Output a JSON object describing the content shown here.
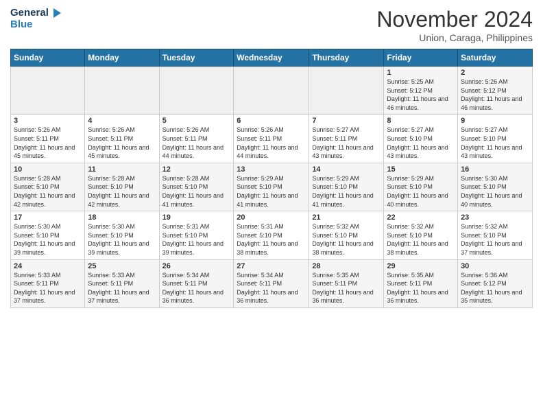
{
  "header": {
    "logo_line1": "General",
    "logo_line2": "Blue",
    "month_title": "November 2024",
    "location": "Union, Caraga, Philippines"
  },
  "weekdays": [
    "Sunday",
    "Monday",
    "Tuesday",
    "Wednesday",
    "Thursday",
    "Friday",
    "Saturday"
  ],
  "weeks": [
    [
      {
        "day": "",
        "sunrise": "",
        "sunset": "",
        "daylight": ""
      },
      {
        "day": "",
        "sunrise": "",
        "sunset": "",
        "daylight": ""
      },
      {
        "day": "",
        "sunrise": "",
        "sunset": "",
        "daylight": ""
      },
      {
        "day": "",
        "sunrise": "",
        "sunset": "",
        "daylight": ""
      },
      {
        "day": "",
        "sunrise": "",
        "sunset": "",
        "daylight": ""
      },
      {
        "day": "1",
        "sunrise": "Sunrise: 5:25 AM",
        "sunset": "Sunset: 5:12 PM",
        "daylight": "Daylight: 11 hours and 46 minutes."
      },
      {
        "day": "2",
        "sunrise": "Sunrise: 5:26 AM",
        "sunset": "Sunset: 5:12 PM",
        "daylight": "Daylight: 11 hours and 46 minutes."
      }
    ],
    [
      {
        "day": "3",
        "sunrise": "Sunrise: 5:26 AM",
        "sunset": "Sunset: 5:11 PM",
        "daylight": "Daylight: 11 hours and 45 minutes."
      },
      {
        "day": "4",
        "sunrise": "Sunrise: 5:26 AM",
        "sunset": "Sunset: 5:11 PM",
        "daylight": "Daylight: 11 hours and 45 minutes."
      },
      {
        "day": "5",
        "sunrise": "Sunrise: 5:26 AM",
        "sunset": "Sunset: 5:11 PM",
        "daylight": "Daylight: 11 hours and 44 minutes."
      },
      {
        "day": "6",
        "sunrise": "Sunrise: 5:26 AM",
        "sunset": "Sunset: 5:11 PM",
        "daylight": "Daylight: 11 hours and 44 minutes."
      },
      {
        "day": "7",
        "sunrise": "Sunrise: 5:27 AM",
        "sunset": "Sunset: 5:11 PM",
        "daylight": "Daylight: 11 hours and 43 minutes."
      },
      {
        "day": "8",
        "sunrise": "Sunrise: 5:27 AM",
        "sunset": "Sunset: 5:10 PM",
        "daylight": "Daylight: 11 hours and 43 minutes."
      },
      {
        "day": "9",
        "sunrise": "Sunrise: 5:27 AM",
        "sunset": "Sunset: 5:10 PM",
        "daylight": "Daylight: 11 hours and 43 minutes."
      }
    ],
    [
      {
        "day": "10",
        "sunrise": "Sunrise: 5:28 AM",
        "sunset": "Sunset: 5:10 PM",
        "daylight": "Daylight: 11 hours and 42 minutes."
      },
      {
        "day": "11",
        "sunrise": "Sunrise: 5:28 AM",
        "sunset": "Sunset: 5:10 PM",
        "daylight": "Daylight: 11 hours and 42 minutes."
      },
      {
        "day": "12",
        "sunrise": "Sunrise: 5:28 AM",
        "sunset": "Sunset: 5:10 PM",
        "daylight": "Daylight: 11 hours and 41 minutes."
      },
      {
        "day": "13",
        "sunrise": "Sunrise: 5:29 AM",
        "sunset": "Sunset: 5:10 PM",
        "daylight": "Daylight: 11 hours and 41 minutes."
      },
      {
        "day": "14",
        "sunrise": "Sunrise: 5:29 AM",
        "sunset": "Sunset: 5:10 PM",
        "daylight": "Daylight: 11 hours and 41 minutes."
      },
      {
        "day": "15",
        "sunrise": "Sunrise: 5:29 AM",
        "sunset": "Sunset: 5:10 PM",
        "daylight": "Daylight: 11 hours and 40 minutes."
      },
      {
        "day": "16",
        "sunrise": "Sunrise: 5:30 AM",
        "sunset": "Sunset: 5:10 PM",
        "daylight": "Daylight: 11 hours and 40 minutes."
      }
    ],
    [
      {
        "day": "17",
        "sunrise": "Sunrise: 5:30 AM",
        "sunset": "Sunset: 5:10 PM",
        "daylight": "Daylight: 11 hours and 39 minutes."
      },
      {
        "day": "18",
        "sunrise": "Sunrise: 5:30 AM",
        "sunset": "Sunset: 5:10 PM",
        "daylight": "Daylight: 11 hours and 39 minutes."
      },
      {
        "day": "19",
        "sunrise": "Sunrise: 5:31 AM",
        "sunset": "Sunset: 5:10 PM",
        "daylight": "Daylight: 11 hours and 39 minutes."
      },
      {
        "day": "20",
        "sunrise": "Sunrise: 5:31 AM",
        "sunset": "Sunset: 5:10 PM",
        "daylight": "Daylight: 11 hours and 38 minutes."
      },
      {
        "day": "21",
        "sunrise": "Sunrise: 5:32 AM",
        "sunset": "Sunset: 5:10 PM",
        "daylight": "Daylight: 11 hours and 38 minutes."
      },
      {
        "day": "22",
        "sunrise": "Sunrise: 5:32 AM",
        "sunset": "Sunset: 5:10 PM",
        "daylight": "Daylight: 11 hours and 38 minutes."
      },
      {
        "day": "23",
        "sunrise": "Sunrise: 5:32 AM",
        "sunset": "Sunset: 5:10 PM",
        "daylight": "Daylight: 11 hours and 37 minutes."
      }
    ],
    [
      {
        "day": "24",
        "sunrise": "Sunrise: 5:33 AM",
        "sunset": "Sunset: 5:11 PM",
        "daylight": "Daylight: 11 hours and 37 minutes."
      },
      {
        "day": "25",
        "sunrise": "Sunrise: 5:33 AM",
        "sunset": "Sunset: 5:11 PM",
        "daylight": "Daylight: 11 hours and 37 minutes."
      },
      {
        "day": "26",
        "sunrise": "Sunrise: 5:34 AM",
        "sunset": "Sunset: 5:11 PM",
        "daylight": "Daylight: 11 hours and 36 minutes."
      },
      {
        "day": "27",
        "sunrise": "Sunrise: 5:34 AM",
        "sunset": "Sunset: 5:11 PM",
        "daylight": "Daylight: 11 hours and 36 minutes."
      },
      {
        "day": "28",
        "sunrise": "Sunrise: 5:35 AM",
        "sunset": "Sunset: 5:11 PM",
        "daylight": "Daylight: 11 hours and 36 minutes."
      },
      {
        "day": "29",
        "sunrise": "Sunrise: 5:35 AM",
        "sunset": "Sunset: 5:11 PM",
        "daylight": "Daylight: 11 hours and 36 minutes."
      },
      {
        "day": "30",
        "sunrise": "Sunrise: 5:36 AM",
        "sunset": "Sunset: 5:12 PM",
        "daylight": "Daylight: 11 hours and 35 minutes."
      }
    ]
  ]
}
